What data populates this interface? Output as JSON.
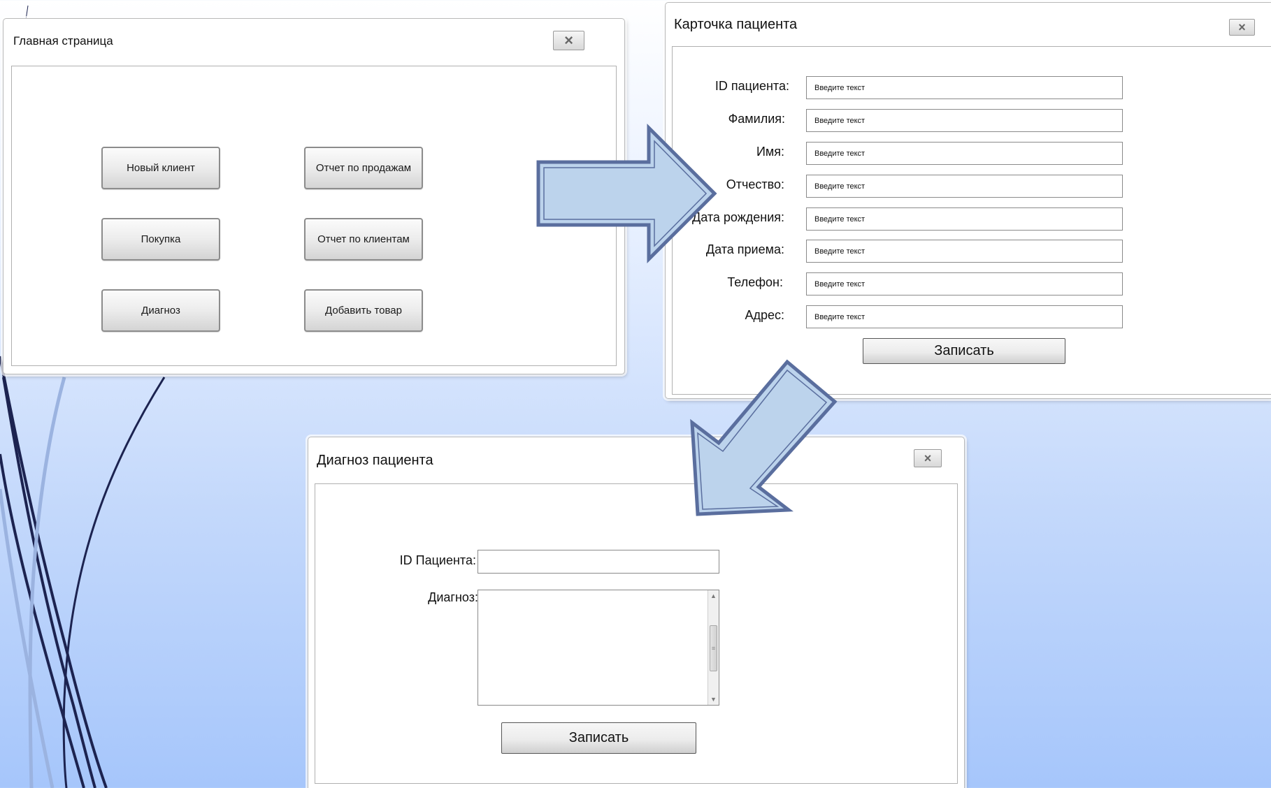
{
  "main_window": {
    "title": "Главная страница",
    "close_glyph": "×",
    "buttons": {
      "new_client": "Новый клиент",
      "purchase": "Покупка",
      "diagnosis": "Диагноз",
      "sales_report": "Отчет по продажам",
      "clients_report": "Отчет по клиентам",
      "add_product": "Добавить товар"
    }
  },
  "patient_card": {
    "title": "Карточка пациента",
    "close_glyph": "×",
    "placeholder": "Введите текст",
    "labels": {
      "patient_id": "ID пациента:",
      "last_name": "Фамилия:",
      "first_name": "Имя:",
      "patronymic": "Отчество:",
      "birth_date": "Дата рождения:",
      "admission_date": "Дата приема:",
      "phone": "Телефон:",
      "address": "Адрес:"
    },
    "save_label": "Записать"
  },
  "diagnosis_window": {
    "title": "Диагноз пациента",
    "close_glyph": "×",
    "labels": {
      "patient_id": "ID Пациента:",
      "diagnosis": "Диагноз:"
    },
    "scroll_up_glyph": "▲",
    "scroll_down_glyph": "▼",
    "scroll_grip_glyph": "≡",
    "save_label": "Записать"
  },
  "colors": {
    "arrow_fill": "#bcd3ec",
    "arrow_outline": "#5a6e9e",
    "decor_dark": "#1c2350",
    "decor_light": "#9bb3e0"
  }
}
